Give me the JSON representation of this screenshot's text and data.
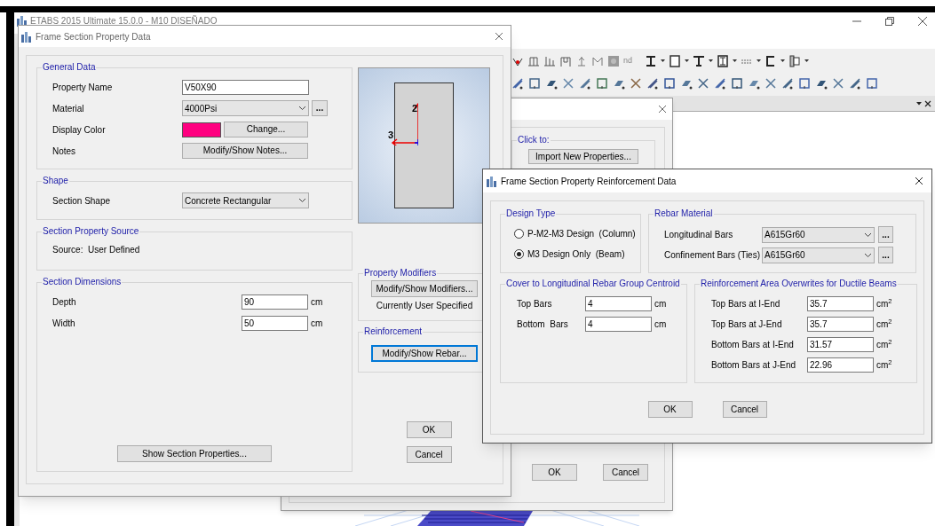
{
  "app_window": {
    "title": "ETABS 2015 Ultimate 15.0.0 - M10 DISEÑADO",
    "toolbar_label": "nd"
  },
  "section_dialog": {
    "title": "Frame Section Property Data",
    "general_data": {
      "title": "General Data",
      "rows": [
        {
          "kind": "text",
          "label": "Property Name",
          "value": "V50X90"
        },
        {
          "kind": "dropdown",
          "label": "Material",
          "value": "4000Psi",
          "more": "..."
        },
        {
          "kind": "color",
          "label": "Display Color",
          "color": "#ff0080",
          "button": "Change..."
        },
        {
          "kind": "button",
          "label": "Notes",
          "button": "Modify/Show Notes..."
        }
      ]
    },
    "shape": {
      "title": "Shape",
      "label": "Section Shape",
      "value": "Concrete Rectangular"
    },
    "source": {
      "title": "Section Property Source",
      "text": "Source:  User Defined"
    },
    "dimensions": {
      "title": "Section Dimensions",
      "rows": [
        {
          "label": "Depth",
          "value": "90",
          "unit": "cm"
        },
        {
          "label": "Width",
          "value": "50",
          "unit": "cm"
        }
      ],
      "button": "Show Section Properties..."
    },
    "preview": {
      "axis_vertical": "2",
      "axis_horizontal": "3"
    },
    "property_modifiers": {
      "title": "Property Modifiers",
      "button": "Modify/Show Modifiers...",
      "status": "Currently User Specified"
    },
    "reinforcement": {
      "title": "Reinforcement",
      "button": "Modify/Show Rebar...",
      "focused": true
    },
    "buttons": [
      "OK",
      "Cancel"
    ]
  },
  "middle_dialog": {
    "group_title": "Click to:",
    "button": "Import New Properties...",
    "buttons": [
      "OK",
      "Cancel"
    ]
  },
  "rebar_dialog": {
    "title": "Frame Section Property Reinforcement Data",
    "design_type": {
      "title": "Design Type",
      "options": [
        {
          "label": "P-M2-M3 Design  (Column)",
          "selected": false
        },
        {
          "label": "M3 Design Only  (Beam)",
          "selected": true
        }
      ]
    },
    "rebar_material": {
      "title": "Rebar Material",
      "rows": [
        {
          "label": "Longitudinal Bars",
          "value": "A615Gr60",
          "more": "..."
        },
        {
          "label": "Confinement Bars (Ties)",
          "value": "A615Gr60",
          "more": "..."
        }
      ]
    },
    "cover": {
      "title": "Cover to Longitudinal Rebar Group Centroid",
      "rows": [
        {
          "label": "Top Bars",
          "value": "4",
          "unit": "cm"
        },
        {
          "label": "Bottom  Bars",
          "value": "4",
          "unit": "cm"
        }
      ]
    },
    "area_overwrites": {
      "title": "Reinforcement Area Overwrites for Ductile Beams",
      "rows": [
        {
          "label": "Top Bars at I-End",
          "value": "35.7",
          "unit": "cm$^{2}$"
        },
        {
          "label": "Top Bars at J-End",
          "value": "35.7",
          "unit": "cm$^{2}$"
        },
        {
          "label": "Bottom Bars at I-End",
          "value": "31.57",
          "unit": "cm$^{2}$"
        },
        {
          "label": "Bottom Bars at J-End",
          "value": "22.96",
          "unit": "cm$^{2}$"
        }
      ]
    },
    "buttons": [
      "OK",
      "Cancel"
    ]
  }
}
